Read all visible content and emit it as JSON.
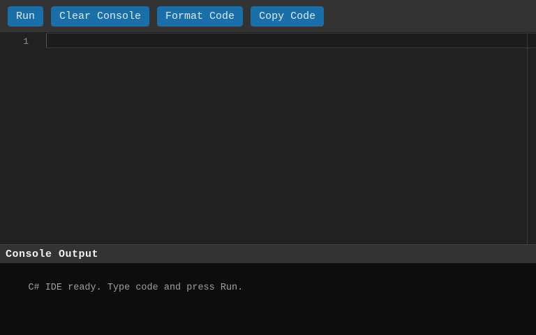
{
  "toolbar": {
    "buttons": [
      {
        "id": "run",
        "label": "Run"
      },
      {
        "id": "clear-console",
        "label": "Clear Console"
      },
      {
        "id": "format-code",
        "label": "Format Code"
      },
      {
        "id": "copy-code",
        "label": "Copy Code"
      }
    ]
  },
  "editor": {
    "line_numbers": {
      "0": "1"
    },
    "code": "",
    "cursor": {
      "line": 1,
      "column": 0
    }
  },
  "console": {
    "title": "Console Output",
    "lines": {
      "0": "C# IDE ready. Type code and press Run."
    }
  },
  "colors": {
    "accent_button": "#1a6fa8",
    "toolbar_bg": "#333333",
    "editor_bg": "#212121",
    "console_header_bg": "#333333",
    "console_bg": "#0d0d0d",
    "console_text": "#9e9e9e"
  }
}
